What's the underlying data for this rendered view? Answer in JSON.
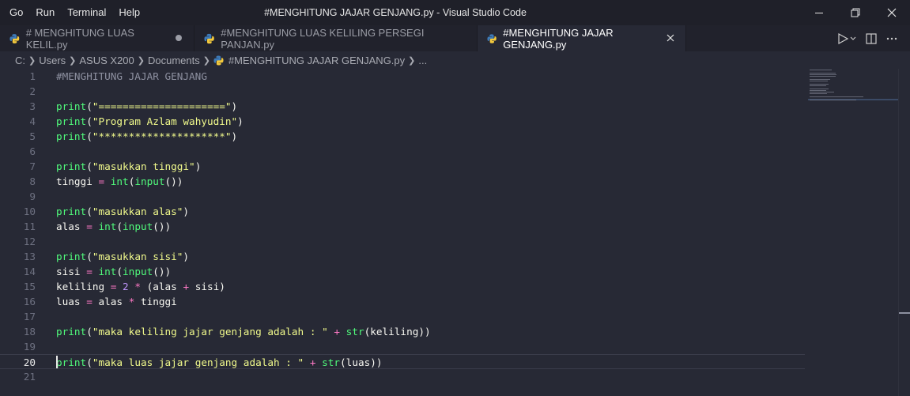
{
  "menu": [
    "Go",
    "Run",
    "Terminal",
    "Help"
  ],
  "window_title": "#MENGHITUNG JAJAR GENJANG.py - Visual Studio Code",
  "tabs": [
    {
      "label": "# MENGHITUNG LUAS KELIL.py",
      "state": "modified"
    },
    {
      "label": "#MENGHITUNG LUAS KELILING PERSEGI PANJAN.py",
      "state": "normal"
    },
    {
      "label": "#MENGHITUNG JAJAR GENJANG.py",
      "state": "active"
    }
  ],
  "breadcrumb": [
    "C:",
    "Users",
    "ASUS X200",
    "Documents",
    "#MENGHITUNG JAJAR GENJANG.py",
    "..."
  ],
  "current_line": 20,
  "code_lines": [
    {
      "n": "1",
      "tokens": [
        {
          "t": "cm",
          "v": "#MENGHITUNG JAJAR GENJANG"
        }
      ]
    },
    {
      "n": "2",
      "tokens": []
    },
    {
      "n": "3",
      "tokens": [
        {
          "t": "fn",
          "v": "print"
        },
        {
          "t": "tx",
          "v": "("
        },
        {
          "t": "str",
          "v": "\"=====================\""
        },
        {
          "t": "tx",
          "v": ")"
        }
      ]
    },
    {
      "n": "4",
      "tokens": [
        {
          "t": "fn",
          "v": "print"
        },
        {
          "t": "tx",
          "v": "("
        },
        {
          "t": "str",
          "v": "\"Program Azlam wahyudin\""
        },
        {
          "t": "tx",
          "v": ")"
        }
      ]
    },
    {
      "n": "5",
      "tokens": [
        {
          "t": "fn",
          "v": "print"
        },
        {
          "t": "tx",
          "v": "("
        },
        {
          "t": "str",
          "v": "\"*********************\""
        },
        {
          "t": "tx",
          "v": ")"
        }
      ]
    },
    {
      "n": "6",
      "tokens": []
    },
    {
      "n": "7",
      "tokens": [
        {
          "t": "fn",
          "v": "print"
        },
        {
          "t": "tx",
          "v": "("
        },
        {
          "t": "str",
          "v": "\"masukkan tinggi\""
        },
        {
          "t": "tx",
          "v": ")"
        }
      ]
    },
    {
      "n": "8",
      "tokens": [
        {
          "t": "tx",
          "v": "tinggi "
        },
        {
          "t": "op",
          "v": "="
        },
        {
          "t": "tx",
          "v": " "
        },
        {
          "t": "fn",
          "v": "int"
        },
        {
          "t": "tx",
          "v": "("
        },
        {
          "t": "fn",
          "v": "input"
        },
        {
          "t": "tx",
          "v": "())"
        }
      ]
    },
    {
      "n": "9",
      "tokens": []
    },
    {
      "n": "10",
      "tokens": [
        {
          "t": "fn",
          "v": "print"
        },
        {
          "t": "tx",
          "v": "("
        },
        {
          "t": "str",
          "v": "\"masukkan alas\""
        },
        {
          "t": "tx",
          "v": ")"
        }
      ]
    },
    {
      "n": "11",
      "tokens": [
        {
          "t": "tx",
          "v": "alas "
        },
        {
          "t": "op",
          "v": "="
        },
        {
          "t": "tx",
          "v": " "
        },
        {
          "t": "fn",
          "v": "int"
        },
        {
          "t": "tx",
          "v": "("
        },
        {
          "t": "fn",
          "v": "input"
        },
        {
          "t": "tx",
          "v": "())"
        }
      ]
    },
    {
      "n": "12",
      "tokens": []
    },
    {
      "n": "13",
      "tokens": [
        {
          "t": "fn",
          "v": "print"
        },
        {
          "t": "tx",
          "v": "("
        },
        {
          "t": "str",
          "v": "\"masukkan sisi\""
        },
        {
          "t": "tx",
          "v": ")"
        }
      ]
    },
    {
      "n": "14",
      "tokens": [
        {
          "t": "tx",
          "v": "sisi "
        },
        {
          "t": "op",
          "v": "="
        },
        {
          "t": "tx",
          "v": " "
        },
        {
          "t": "fn",
          "v": "int"
        },
        {
          "t": "tx",
          "v": "("
        },
        {
          "t": "fn",
          "v": "input"
        },
        {
          "t": "tx",
          "v": "())"
        }
      ]
    },
    {
      "n": "15",
      "tokens": [
        {
          "t": "tx",
          "v": "keliling "
        },
        {
          "t": "op",
          "v": "="
        },
        {
          "t": "tx",
          "v": " "
        },
        {
          "t": "num",
          "v": "2"
        },
        {
          "t": "tx",
          "v": " "
        },
        {
          "t": "op",
          "v": "*"
        },
        {
          "t": "tx",
          "v": " (alas "
        },
        {
          "t": "op",
          "v": "+"
        },
        {
          "t": "tx",
          "v": " sisi)"
        }
      ]
    },
    {
      "n": "16",
      "tokens": [
        {
          "t": "tx",
          "v": "luas "
        },
        {
          "t": "op",
          "v": "="
        },
        {
          "t": "tx",
          "v": " alas "
        },
        {
          "t": "op",
          "v": "*"
        },
        {
          "t": "tx",
          "v": " tinggi"
        }
      ]
    },
    {
      "n": "17",
      "tokens": []
    },
    {
      "n": "18",
      "tokens": [
        {
          "t": "fn",
          "v": "print"
        },
        {
          "t": "tx",
          "v": "("
        },
        {
          "t": "str",
          "v": "\"maka keliling jajar genjang adalah : \""
        },
        {
          "t": "tx",
          "v": " "
        },
        {
          "t": "op",
          "v": "+"
        },
        {
          "t": "tx",
          "v": " "
        },
        {
          "t": "fn",
          "v": "str"
        },
        {
          "t": "tx",
          "v": "(keliling))"
        }
      ]
    },
    {
      "n": "19",
      "tokens": []
    },
    {
      "n": "20",
      "tokens": [
        {
          "t": "fn",
          "v": "print"
        },
        {
          "t": "tx",
          "v": "("
        },
        {
          "t": "str",
          "v": "\"maka luas jajar genjang adalah : \""
        },
        {
          "t": "tx",
          "v": " "
        },
        {
          "t": "op",
          "v": "+"
        },
        {
          "t": "tx",
          "v": " "
        },
        {
          "t": "fn",
          "v": "str"
        },
        {
          "t": "tx",
          "v": "(luas))"
        }
      ]
    },
    {
      "n": "21",
      "tokens": []
    }
  ],
  "colors": {
    "function": "#50fa7b",
    "string": "#f1fa8c",
    "operator": "#ff79c6",
    "number": "#bd93f9",
    "comment": "#8d90a0",
    "text": "#f8f8f2",
    "python_icon_blue": "#3d7ab8",
    "python_icon_yellow": "#f3c93d"
  },
  "icons": {
    "tab_file": "python-icon",
    "modified": "dot-icon",
    "close": "close-icon",
    "run": "run-icon",
    "split": "split-editor-icon",
    "more": "more-icon"
  }
}
